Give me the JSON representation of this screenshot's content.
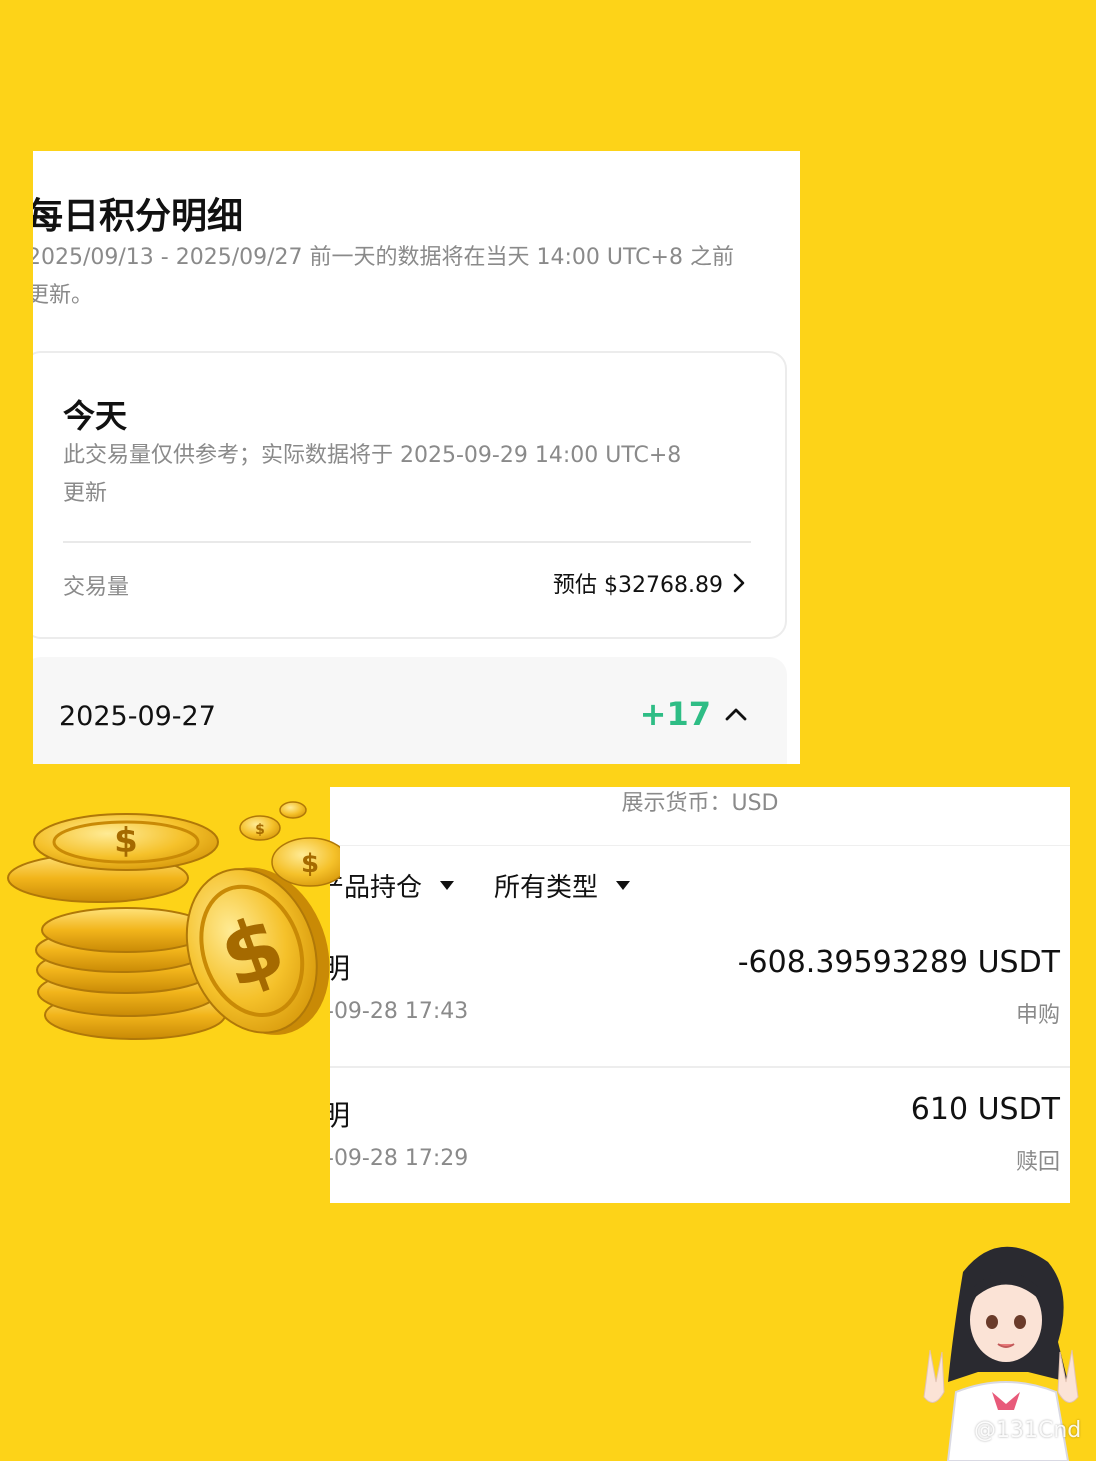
{
  "daily_points": {
    "title": "每日积分明细",
    "date_range_note_line1": "2025/09/13 - 2025/09/27 前一天的数据将在当天 14:00 UTC+8 之前",
    "date_range_note_line2": "更新。",
    "today": {
      "title": "今天",
      "note_line1": "此交易量仅供参考；实际数据将于 2025-09-29 14:00 UTC+8",
      "note_line2": "更新",
      "volume_label": "交易量",
      "volume_value": "预估 $32768.89"
    },
    "day_row": {
      "date": "2025-09-27",
      "points": "+17"
    }
  },
  "transactions": {
    "display_currency": "展示货币：USD",
    "filters": [
      {
        "label": "产品持仓"
      },
      {
        "label": "所有类型"
      }
    ],
    "items": [
      {
        "title": "明",
        "time": "-09-28 17:43",
        "amount": "-608.39593289 USDT",
        "type": "申购"
      },
      {
        "title": "明",
        "time": "-09-28 17:29",
        "amount": "610 USDT",
        "type": "赎回"
      }
    ]
  },
  "watermark": "@131Cnd",
  "colors": {
    "background": "#FDD318",
    "positive": "#2ebd85",
    "muted_text": "#8a8a8a"
  }
}
